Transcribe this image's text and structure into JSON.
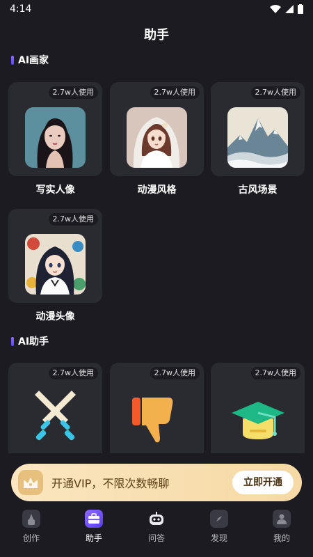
{
  "status_bar": {
    "time": "4:14"
  },
  "page": {
    "title": "助手"
  },
  "sections": {
    "painter": {
      "title": "AI画家"
    },
    "assistant": {
      "title": "AI助手"
    }
  },
  "painter_cards": [
    {
      "usage": "2.7w人使用",
      "label": "写实人像",
      "icon": "realistic-portrait-image"
    },
    {
      "usage": "2.7w人使用",
      "label": "动漫风格",
      "icon": "anime-style-image"
    },
    {
      "usage": "2.7w人使用",
      "label": "古风场景",
      "icon": "ancient-landscape-image"
    },
    {
      "usage": "2.7w人使用",
      "label": "动漫头像",
      "icon": "anime-avatar-image"
    }
  ],
  "assistant_cards": [
    {
      "usage": "2.7w人使用",
      "icon": "crossed-swords-icon"
    },
    {
      "usage": "2.7w人使用",
      "icon": "thumbs-down-icon"
    },
    {
      "usage": "2.7w人使用",
      "icon": "graduation-cap-icon"
    }
  ],
  "vip_banner": {
    "text": "开通VIP，不限次数畅聊",
    "button": "立即开通"
  },
  "tabs": [
    {
      "label": "创作",
      "icon": "create-icon",
      "active": false
    },
    {
      "label": "助手",
      "icon": "assistant-briefcase-icon",
      "active": true
    },
    {
      "label": "问答",
      "icon": "robot-icon",
      "active": false
    },
    {
      "label": "发现",
      "icon": "compass-icon",
      "active": false
    },
    {
      "label": "我的",
      "icon": "profile-icon",
      "active": false
    }
  ],
  "colors": {
    "background": "#1b1b21",
    "card": "#2a2a31",
    "accent": "#7a5cff",
    "vip_gradient_start": "#fbe6c0",
    "vip_gradient_end": "#f6d9a4"
  }
}
